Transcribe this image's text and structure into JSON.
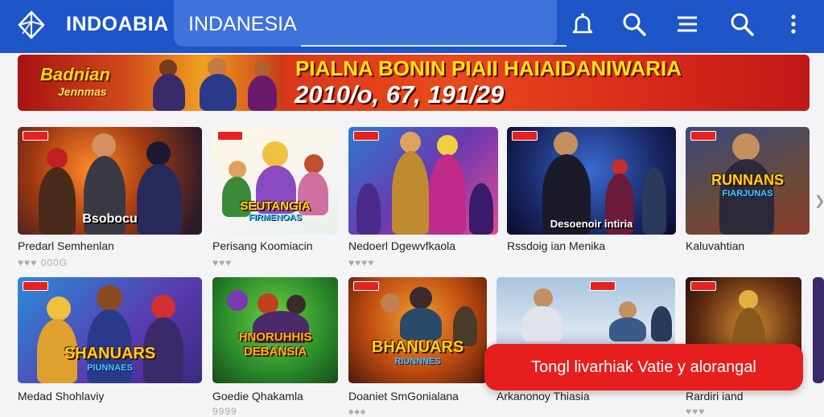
{
  "header": {
    "brand": "INDOABIA",
    "search_value": "INDANESIA",
    "icons": [
      "logo-icon",
      "notification-bell-icon",
      "search-icon",
      "menu-icon",
      "search-icon",
      "more-vertical-icon"
    ]
  },
  "banner": {
    "logo_line1": "Badnian",
    "logo_line2": "Jennmas",
    "title": "PIALNA BONIN PIAII HAIAIDANIWARIA",
    "subtitle": "2010/o, 67, 191/29"
  },
  "row1": [
    {
      "title": "Predarl Semhenlan",
      "rating": "♥♥♥ 000G",
      "caption": "Bsobocu"
    },
    {
      "title": "Perisang Koomiacin",
      "rating": "♥♥♥",
      "logo": "SEUTANGIA",
      "logo_sub": "FIRMENOAS"
    },
    {
      "title": "Nedoerl Dgewvfkaola",
      "rating": "♥♥♥♥"
    },
    {
      "title": "Rssdoig ian Menika",
      "rating": "",
      "caption": "Desoenoir intiria"
    },
    {
      "title": "Kaluvahtian",
      "rating": "",
      "logo": "RUNNANS",
      "logo_sub": "FIARJUNAS"
    }
  ],
  "row2": [
    {
      "title": "Medad Shohlaviy",
      "rating": "",
      "logo": "SHANUARS",
      "logo_sub": "PIUNNAES"
    },
    {
      "title": "Goedie Qhakamla",
      "rating": "9999",
      "logo": "HNORUHHIS DEBANSIA"
    },
    {
      "title": "Doaniet SmGonialana",
      "rating": "♠♠♠",
      "logo": "BHANUARS",
      "logo_sub": "RIUNNNES"
    },
    {
      "title": "Arkanonoy Thiasia",
      "rating": ""
    },
    {
      "title": "Rardiri iand",
      "rating": "♥♥♥"
    }
  ],
  "toast": {
    "text": "Tongl livarhiak Vatie y alorangal"
  },
  "colors": {
    "topbar": "#1e56c8",
    "search": "#3f72da",
    "accent": "#e61e1e",
    "banner_text": "#ffe21a"
  }
}
